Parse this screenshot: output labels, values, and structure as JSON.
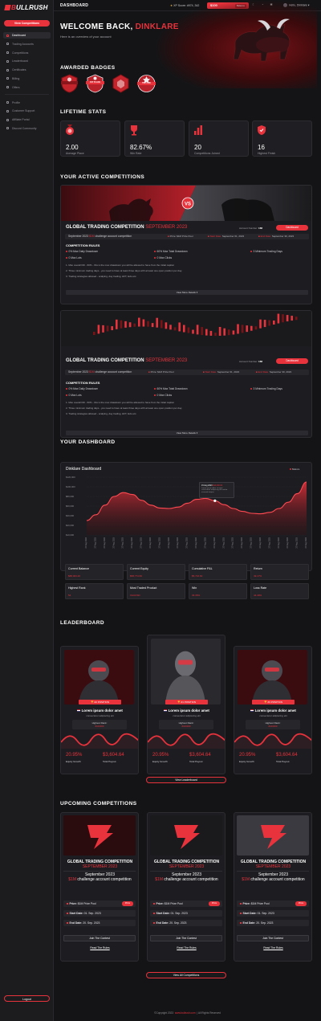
{
  "sidebar": {
    "logo_prefix": "B",
    "logo_main": "ULL",
    "logo_accent": "RUSH",
    "view_competitions_label": "View Competitions",
    "nav": [
      {
        "label": "Dashboard",
        "active": true
      },
      {
        "label": "Trading Accounts"
      },
      {
        "label": "Competitions"
      },
      {
        "label": "Leaderboard"
      },
      {
        "label": "Certificates"
      },
      {
        "label": "Billing"
      },
      {
        "label": "Offers"
      }
    ],
    "nav2": [
      {
        "label": "Profile"
      },
      {
        "label": "Customer Support"
      },
      {
        "label": "Affiliate Portal"
      },
      {
        "label": "Discord Community"
      }
    ],
    "logout_label": "Logout"
  },
  "topbar": {
    "title": "DASHBOARD",
    "xp_label": "XP Score",
    "xp_value": "#974, 342",
    "balance": "$100",
    "balance_sub": "Balance",
    "hello": "Hello, Dinklare"
  },
  "hero": {
    "welcome": "WELCOME BACK,",
    "name": "DINKLARE",
    "subtitle": "Here is an overview of your account"
  },
  "badges": {
    "heading": "AWARDED BADGES",
    "items": [
      "",
      "1ST PLACE",
      "",
      "TOP FIVE"
    ]
  },
  "lifetime": {
    "heading": "LIFETIME STATS",
    "stats": [
      {
        "value": "2.00",
        "label": "Average Place",
        "icon": "medal-icon"
      },
      {
        "value": "82.67%",
        "label": "Win Rate",
        "icon": "trophy-icon"
      },
      {
        "value": "20",
        "label": "Competitions Joined",
        "icon": "bar-chart-icon"
      },
      {
        "value": "16",
        "label": "Highest Finish",
        "icon": "shield-icon"
      }
    ]
  },
  "active": {
    "heading": "YOUR ACTIVE COMPETITIONS",
    "cards": [
      {
        "title": "GLOBAL TRADING COMPETITION",
        "month": "SEPTEMBER 2023",
        "account_label": "Account Number:",
        "account_no": "168",
        "dash_btn": "Dashboard",
        "strip_prefix": "September 2023",
        "strip_amount": "$1M",
        "strip_suffix": "challenge account competition",
        "prize_label": "Prize:",
        "prize_value": "$1M Prize Pool",
        "start_label": "Start Date:",
        "start_value": "September 01, 2023",
        "end_label": "End Date:",
        "end_value": "September 30, 2023",
        "rules_heading": "COMPETITION RULES",
        "rules": [
          "0% Max Daily Drawdown",
          "60% Max Total Drawdown",
          "3 Minimum Trading Days",
          "0 Max Lots",
          "0 Max Clicks"
        ],
        "notes": [
          "1. Max overall DD - 60% - this is the max drawdown you will be allowed to have from the initial capital.",
          "2. Three minimum trading days - you need to have at least three days with at least one open position per day.",
          "3. Trading strategies allowed - scalping, day trading, HFT, EAs etc."
        ],
        "more": "View More Details ▾"
      },
      {
        "title": "GLOBAL TRADING COMPETITION",
        "month": "SEPTEMBER 2023",
        "account_label": "Account Number:",
        "account_no": "168",
        "dash_btn": "Dashboard",
        "strip_prefix": "September 2023",
        "strip_amount": "$1M",
        "strip_suffix": "challenge account competition",
        "prize_label": "Prize:",
        "prize_value": "$1M Prize Pool",
        "start_label": "Start Date:",
        "start_value": "September 01, 2023",
        "end_label": "End Date:",
        "end_value": "September 30, 2023",
        "rules_heading": "COMPETITION RULES",
        "rules": [
          "0% Max Daily Drawdown",
          "60% Max Total Drawdown",
          "3 Minimum Trading Days",
          "0 Max Lots",
          "0 Max Clicks"
        ],
        "notes": [
          "1. Max overall DD - 60% - this is the max drawdown you will be allowed to have from the initial capital.",
          "2. Three minimum trading days - you need to have at least three days with at least one open position per day.",
          "3. Trading strategies allowed - scalping, day trading, HFT, EAs etc."
        ],
        "more": "View More Details ▾"
      }
    ]
  },
  "dashboard": {
    "heading": "YOUR DASHBOARD",
    "panel_title": "Dinklare Dashboard",
    "legend": "Balance",
    "tooltip_date": "15 Aug 2023",
    "tooltip_value": "$10,000.00",
    "tooltip_text": "Lorem ipsum dolor sit amet consectetur adipiscing elit sed do eiusmod tempor",
    "tiles": [
      {
        "label": "Current Balance",
        "value": "$88,003.20"
      },
      {
        "label": "Current Equity",
        "value": "$58,774.60"
      },
      {
        "label": "Cumulative P&L",
        "value": "$5,716.60"
      },
      {
        "label": "Return",
        "value": "49.17%"
      },
      {
        "label": "Highest Rank",
        "value": "54"
      },
      {
        "label": "Most Traded Product",
        "value": "XAUUSD"
      },
      {
        "label": "Win",
        "value": "33.36%"
      },
      {
        "label": "Loss Rate",
        "value": "44.49%"
      }
    ]
  },
  "chart_data": {
    "type": "area",
    "title": "Dinklare Dashboard",
    "ylim": [
      0,
      120000
    ],
    "yticks": [
      "$120,000",
      "$100,000",
      "$80,000",
      "$60,000",
      "$40,000",
      "$20,000",
      "$10,000"
    ],
    "x": [
      "27 Aug 2023",
      "27 Aug 2023",
      "27 Aug 2023",
      "27 Aug 2023",
      "27 Aug 2023",
      "27 Aug 2023",
      "27 Aug 2023",
      "27 Aug 2023",
      "27 Aug 2023",
      "27 Aug 2023",
      "27 Aug 2023",
      "27 Aug 2023",
      "27 Aug 2023",
      "27 Aug 2023",
      "27 Aug 2023",
      "27 Aug 2023",
      "27 Aug 2023",
      "27 Aug 2023",
      "27 Aug 2023",
      "27 Aug 2023",
      "27 Aug 2023",
      "27 Aug 2023",
      "27 Aug 2023",
      "27 Aug 2023",
      "27 Aug 2023"
    ],
    "series": [
      {
        "name": "Balance",
        "values": [
          30000,
          42000,
          62000,
          80000,
          88000,
          84000,
          72000,
          62000,
          56000,
          55000,
          58000,
          66000,
          74000,
          76000,
          71000,
          63000,
          55000,
          49000,
          45000,
          44000,
          47000,
          55000,
          68000,
          86000,
          110000
        ]
      }
    ]
  },
  "leaderboard": {
    "heading": "LEADERBOARD",
    "cards": [
      {
        "position": "#2 POSITION",
        "name": "Lorem ipsum dolor amet",
        "sub": "consectetur adipiscing elit",
        "rank_label": "Highest Rank:",
        "rank_value": "#100000",
        "pct": "20.95%",
        "amt": "$3,604.64",
        "pct_label": "Equity Growth",
        "amt_label": "Total Payout"
      },
      {
        "position": "#1 POSITION",
        "name": "Lorem ipsum dolor amet",
        "sub": "consectetur adipiscing elit",
        "rank_label": "Highest Rank:",
        "rank_value": "#100000",
        "pct": "20.95%",
        "amt": "$3,604.64",
        "pct_label": "Equity Growth",
        "amt_label": "Total Payout"
      },
      {
        "position": "#3 POSITION",
        "name": "Lorem ipsum dolor amet",
        "sub": "consectetur adipiscing elit",
        "rank_label": "Highest Rank:",
        "rank_value": "#100000",
        "pct": "20.95%",
        "amt": "$3,604.64",
        "pct_label": "Equity Growth",
        "amt_label": "Total Payout"
      }
    ],
    "view_btn": "View Leaderboard"
  },
  "upcoming": {
    "heading": "UPCOMING COMPETITIONS",
    "cards": [
      {
        "title": "GLOBAL TRADING COMPETITION",
        "month": "SEPTEMBER 2023",
        "desc1": "September 2023",
        "desc_amt": "$1M",
        "desc2": "challenge account competition",
        "prize_label": "Prize:",
        "prize": "$1M Prize Pool",
        "prize_btn": "Prize",
        "start_label": "Start Date:",
        "start": "01. Sep. 2023",
        "end_label": "End Date:",
        "end": "20. Sep. 2023",
        "join": "Join The Contest",
        "rules": "Read The Rules"
      },
      {
        "title": "GLOBAL TRADING COMPETITION",
        "month": "SEPTEMBER 2023",
        "desc1": "September 2023",
        "desc_amt": "$1M",
        "desc2": "challenge account competition",
        "prize_label": "Prize:",
        "prize": "$1M Prize Pool",
        "prize_btn": "Prize",
        "start_label": "Start Date:",
        "start": "01. Sep. 2023",
        "end_label": "End Date:",
        "end": "20. Sep. 2023",
        "join": "Join The Contest",
        "rules": "Read The Rules"
      },
      {
        "title": "GLOBAL TRADING COMPETITION",
        "month": "SEPTEMBER 2023",
        "desc1": "September 2023",
        "desc_amt": "$1M",
        "desc2": "challenge account competition",
        "prize_label": "Prize:",
        "prize": "$1M Prize Pool",
        "prize_btn": "Prize",
        "start_label": "Start Date:",
        "start": "01. Sep. 2023",
        "end_label": "End Date:",
        "end": "20. Sep. 2023",
        "join": "Join The Contest",
        "rules": "Read The Rules"
      }
    ],
    "view_btn": "View All Competitions"
  },
  "footer": {
    "copyright": "©Copyright 2023",
    "link": "www.bullrush.com",
    "rights": "| All Rights Reserved"
  },
  "colors": {
    "accent": "#e8323c",
    "background": "#141416",
    "card": "#1d1d21"
  }
}
